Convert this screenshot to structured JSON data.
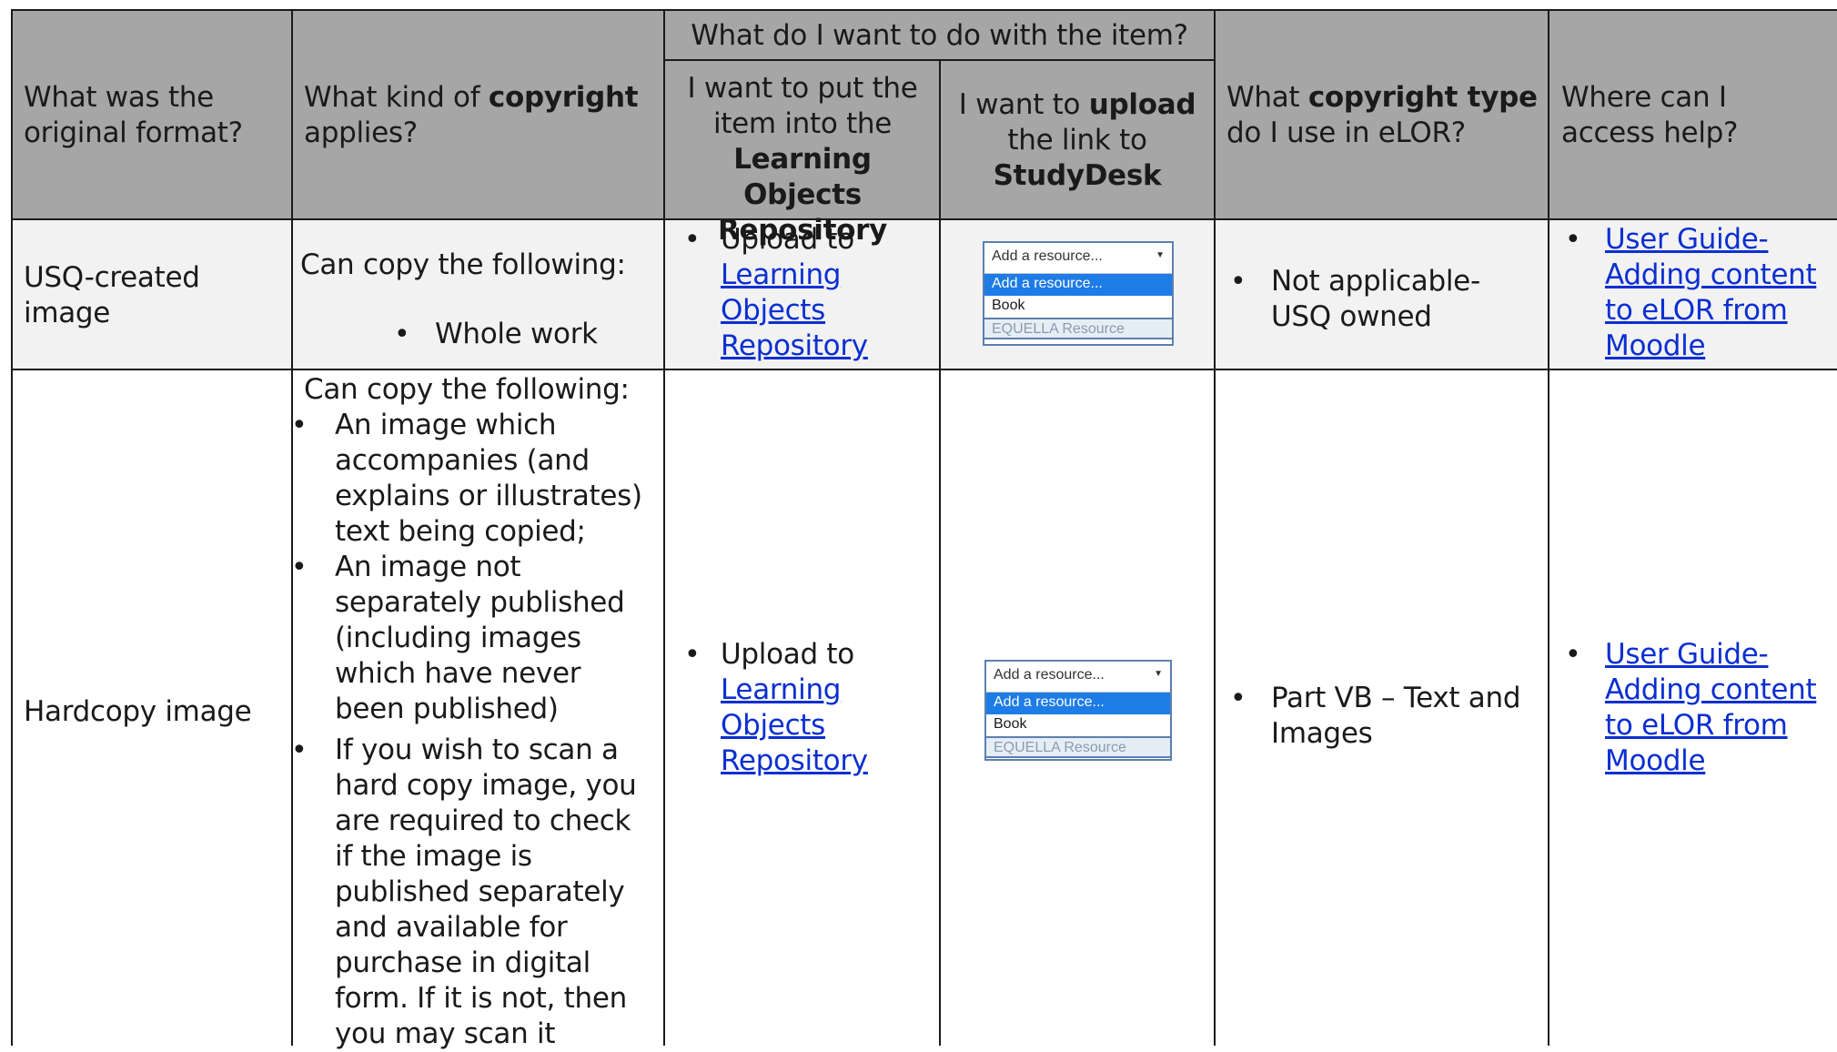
{
  "header": {
    "col1": "What was the original format?",
    "col2_pre": "What kind of ",
    "col2_bold": "copyright",
    "col2_post": "applies?",
    "group": "What do I want to do with the item?",
    "col3_pre": "I want to put the item into the",
    "col3_bold": "Learning Objects Repository",
    "col4_pre": "I want to ",
    "col4_bold1": "upload",
    "col4_mid": "the link to",
    "col4_bold2": "StudyDesk",
    "col5_pre": "What ",
    "col5_bold": "copyright type",
    "col5_post": "do I use in eLOR?",
    "col6": "Where can I access help?"
  },
  "rows": [
    {
      "format": "USQ-created image",
      "copy_intro": "Can copy the following:",
      "copy_items": [
        "Whole work"
      ],
      "lor_text": "Upload to",
      "lor_link": "Learning Objects Repository",
      "dropdown": {
        "placeholder": "Add a resource...",
        "options": [
          "Add a resource...",
          "Book",
          "EQUELLA Resource"
        ]
      },
      "type_items": [
        "Not applicable- USQ owned"
      ],
      "help_link": "User Guide- Adding content to eLOR from Moodle"
    },
    {
      "format": "Hardcopy image",
      "copy_intro": "Can copy the following:",
      "copy_items": [
        "An image which accompanies (and explains or illustrates) text being copied;",
        "An image not separately published (including images which have never been published)",
        "If you wish to scan a hard copy image, you are required to check if the image is published separately and available for purchase in digital form. If it is not, then you may scan it"
      ],
      "lor_text": "Upload to",
      "lor_link": "Learning Objects Repository",
      "dropdown": {
        "placeholder": "Add a resource...",
        "options": [
          "Add a resource...",
          "Book",
          "EQUELLA Resource"
        ]
      },
      "type_items": [
        "Part VB – Text and Images"
      ],
      "help_link": "User Guide- Adding content to eLOR from Moodle"
    }
  ],
  "colors": {
    "header_bg": "#a6a6a6",
    "row1_bg": "#f2f2f2",
    "link": "#0b2fd1",
    "dropdown_selected": "#1e7ce6"
  }
}
